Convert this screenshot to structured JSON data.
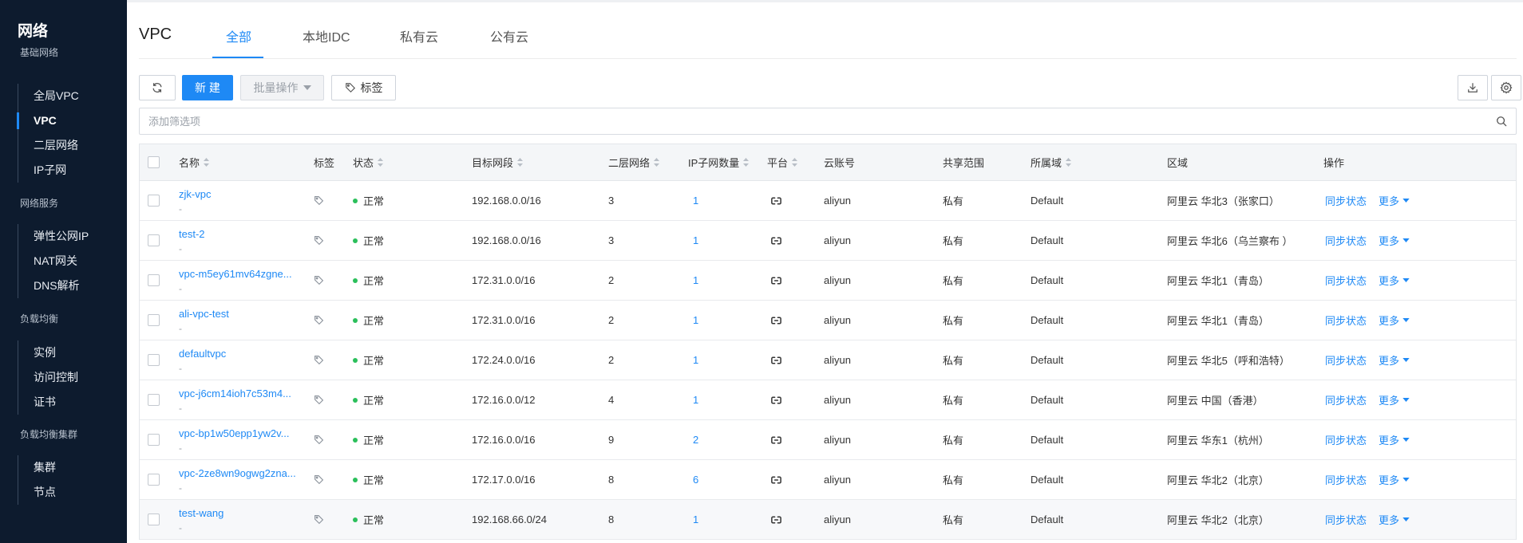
{
  "sidebar": {
    "title": "网络",
    "groups": [
      {
        "label": "基础网络",
        "items": [
          "全局VPC",
          "VPC",
          "二层网络",
          "IP子网"
        ]
      },
      {
        "label": "网络服务",
        "items": [
          "弹性公网IP",
          "NAT网关",
          "DNS解析"
        ]
      },
      {
        "label": "负载均衡",
        "items": [
          "实例",
          "访问控制",
          "证书"
        ]
      },
      {
        "label": "负载均衡集群",
        "items": [
          "集群",
          "节点"
        ]
      }
    ],
    "active_item": "VPC"
  },
  "header": {
    "title": "VPC",
    "tabs": [
      "全部",
      "本地IDC",
      "私有云",
      "公有云"
    ],
    "active_tab": "全部"
  },
  "toolbar": {
    "refresh_icon": "refresh-icon",
    "new_label": "新 建",
    "batch_label": "批量操作",
    "tag_label": "标签",
    "download_icon": "download-icon",
    "settings_icon": "gear-icon"
  },
  "filter": {
    "placeholder": "添加筛选项"
  },
  "colors": {
    "accent": "#1e89f5",
    "sidebar_bg": "#0d1b2e",
    "status_ok": "#2bbf5b"
  },
  "table": {
    "headers": {
      "name": "名称",
      "tag": "标签",
      "status": "状态",
      "cidr": "目标网段",
      "l2": "二层网络",
      "subnets": "IP子网数量",
      "platform": "平台",
      "account": "云账号",
      "share": "共享范围",
      "domain": "所属域",
      "region": "区域",
      "ops": "操作"
    },
    "rows": [
      {
        "name": "zjk-vpc",
        "sub": "-",
        "status": "正常",
        "cidr": "192.168.0.0/16",
        "l2": "3",
        "subnets": "1",
        "account": "aliyun",
        "share": "私有",
        "domain": "Default",
        "region": "阿里云 华北3（张家口）",
        "sync": "同步状态",
        "more": "更多"
      },
      {
        "name": "test-2",
        "sub": "-",
        "status": "正常",
        "cidr": "192.168.0.0/16",
        "l2": "3",
        "subnets": "1",
        "account": "aliyun",
        "share": "私有",
        "domain": "Default",
        "region": "阿里云 华北6（乌兰察布 ）",
        "sync": "同步状态",
        "more": "更多"
      },
      {
        "name": "vpc-m5ey61mv64zgne...",
        "sub": "-",
        "status": "正常",
        "cidr": "172.31.0.0/16",
        "l2": "2",
        "subnets": "1",
        "account": "aliyun",
        "share": "私有",
        "domain": "Default",
        "region": "阿里云 华北1（青岛）",
        "sync": "同步状态",
        "more": "更多"
      },
      {
        "name": "ali-vpc-test",
        "sub": "-",
        "status": "正常",
        "cidr": "172.31.0.0/16",
        "l2": "2",
        "subnets": "1",
        "account": "aliyun",
        "share": "私有",
        "domain": "Default",
        "region": "阿里云 华北1（青岛）",
        "sync": "同步状态",
        "more": "更多"
      },
      {
        "name": "defaultvpc",
        "sub": "-",
        "status": "正常",
        "cidr": "172.24.0.0/16",
        "l2": "2",
        "subnets": "1",
        "account": "aliyun",
        "share": "私有",
        "domain": "Default",
        "region": "阿里云 华北5（呼和浩特）",
        "sync": "同步状态",
        "more": "更多"
      },
      {
        "name": "vpc-j6cm14ioh7c53m4...",
        "sub": "-",
        "status": "正常",
        "cidr": "172.16.0.0/12",
        "l2": "4",
        "subnets": "1",
        "account": "aliyun",
        "share": "私有",
        "domain": "Default",
        "region": "阿里云 中国（香港）",
        "sync": "同步状态",
        "more": "更多"
      },
      {
        "name": "vpc-bp1w50epp1yw2v...",
        "sub": "-",
        "status": "正常",
        "cidr": "172.16.0.0/16",
        "l2": "9",
        "subnets": "2",
        "account": "aliyun",
        "share": "私有",
        "domain": "Default",
        "region": "阿里云 华东1（杭州）",
        "sync": "同步状态",
        "more": "更多"
      },
      {
        "name": "vpc-2ze8wn9ogwg2zna...",
        "sub": "-",
        "status": "正常",
        "cidr": "172.17.0.0/16",
        "l2": "8",
        "subnets": "6",
        "account": "aliyun",
        "share": "私有",
        "domain": "Default",
        "region": "阿里云 华北2（北京）",
        "sync": "同步状态",
        "more": "更多"
      },
      {
        "name": "test-wang",
        "sub": "-",
        "status": "正常",
        "cidr": "192.168.66.0/24",
        "l2": "8",
        "subnets": "1",
        "account": "aliyun",
        "share": "私有",
        "domain": "Default",
        "region": "阿里云 华北2（北京）",
        "sync": "同步状态",
        "more": "更多"
      }
    ]
  }
}
